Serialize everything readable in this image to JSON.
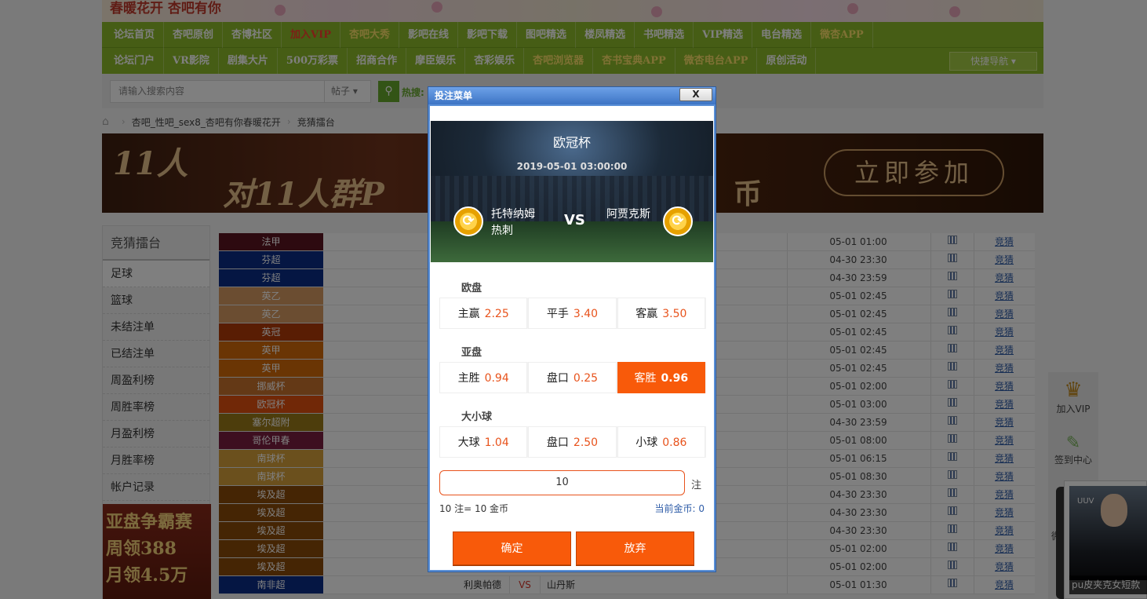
{
  "header": {
    "slogan": "春暖花开 杏吧有你"
  },
  "nav": {
    "row1": [
      "论坛首页",
      "杏吧原创",
      "杏博社区",
      "加入VIP",
      "杏吧大秀",
      "影吧在线",
      "影吧下载",
      "图吧精选",
      "楼凤精选",
      "书吧精选",
      "VIP精选",
      "电台精选",
      "微杏APP"
    ],
    "row2": [
      "论坛门户",
      "VR影院",
      "剧集大片",
      "500万彩票",
      "招商合作",
      "摩臣娱乐",
      "杏彩娱乐",
      "杏吧浏览器",
      "杏书宝典APP",
      "微杏电台APP",
      "原创活动"
    ],
    "quick_nav": "快捷导航 ▾"
  },
  "search": {
    "placeholder": "请输入搜索内容",
    "type": "帖子 ▾",
    "hot_label": "热搜:"
  },
  "breadcrumb": [
    "杏吧_性吧_sex8_杏吧有你春暖花开",
    "竞猜擂台"
  ],
  "ad_banner": {
    "line1": "11人",
    "line2": "对11人群P",
    "tail": "币",
    "cta": "立即参加"
  },
  "sidebar": {
    "title": "竞猜擂台",
    "items": [
      "足球",
      "篮球",
      "未结注单",
      "已结注单",
      "周盈利榜",
      "周胜率榜",
      "月盈利榜",
      "月胜率榜",
      "帐户记录"
    ],
    "ad_lines": [
      "亚盘争霸赛",
      "周领388",
      "月领4.5万"
    ]
  },
  "table": {
    "action_label": "竞猜",
    "rows": [
      {
        "league": "法甲",
        "color": "#5a1420",
        "time": "05-01 01:00"
      },
      {
        "league": "芬超",
        "color": "#0a2d86",
        "time": "04-30 23:30"
      },
      {
        "league": "芬超",
        "color": "#0a2d86",
        "time": "04-30 23:59"
      },
      {
        "league": "英乙",
        "color": "#d79a62",
        "time": "05-01 02:45"
      },
      {
        "league": "英乙",
        "color": "#d79a62",
        "time": "05-01 02:45"
      },
      {
        "league": "英冠",
        "color": "#b23a06",
        "time": "05-01 02:45"
      },
      {
        "league": "英甲",
        "color": "#d46a09",
        "time": "05-01 02:45"
      },
      {
        "league": "英甲",
        "color": "#d46a09",
        "time": "05-01 02:45"
      },
      {
        "league": "挪威杯",
        "color": "#c9722c",
        "time": "05-01 02:00"
      },
      {
        "league": "欧冠杯",
        "color": "#e2510f",
        "time": "05-01 03:00"
      },
      {
        "league": "塞尔超附",
        "color": "#9a7a18",
        "time": "04-30 23:59"
      },
      {
        "league": "哥伦甲春",
        "color": "#7a1f40",
        "time": "05-01 08:00"
      },
      {
        "league": "南球杯",
        "color": "#d6a13a",
        "time": "05-01 06:15"
      },
      {
        "league": "南球杯",
        "color": "#d6a13a",
        "time": "05-01 08:30"
      },
      {
        "league": "埃及超",
        "color": "#8a4a08",
        "time": "04-30 23:30"
      },
      {
        "league": "埃及超",
        "color": "#8a4a08",
        "time": "04-30 23:30"
      },
      {
        "league": "埃及超",
        "color": "#8a4a08",
        "time": "04-30 23:30"
      },
      {
        "league": "埃及超",
        "color": "#8a4a08",
        "time": "05-01 02:00"
      },
      {
        "league": "埃及超",
        "color": "#8a4a08",
        "time": "05-01 02:00"
      },
      {
        "league": "南非超",
        "color": "#0a2d86",
        "time": "05-01 01:30",
        "home": "利奥帕德",
        "vs": "VS",
        "away": "山丹斯"
      }
    ]
  },
  "right_tools": {
    "vip": "加入VIP",
    "checkin": "签到中心",
    "wechat": "微"
  },
  "float_ad": {
    "brand": "UUV",
    "caption": "pu皮夹克女短款"
  },
  "dialog": {
    "title": "投注菜单",
    "close": "X",
    "competition": "欧冠杯",
    "match_time": "2019-05-01 03:00:00",
    "home_team": [
      "托特纳姆",
      "热刺"
    ],
    "away_team": "阿贾克斯",
    "vs": "VS",
    "sections": [
      {
        "label": "欧盘",
        "cells": [
          {
            "name": "主赢",
            "odds": "2.25"
          },
          {
            "name": "平手",
            "odds": "3.40"
          },
          {
            "name": "客赢",
            "odds": "3.50"
          }
        ]
      },
      {
        "label": "亚盘",
        "cells": [
          {
            "name": "主胜",
            "odds": "0.94"
          },
          {
            "name": "盘口",
            "odds": "0.25"
          },
          {
            "name": "客胜",
            "odds": "0.96"
          }
        ]
      },
      {
        "label": "大小球",
        "cells": [
          {
            "name": "大球",
            "odds": "1.04"
          },
          {
            "name": "盘口",
            "odds": "2.50"
          },
          {
            "name": "小球",
            "odds": "0.86"
          }
        ]
      }
    ],
    "bet_value": "10",
    "bet_unit": "注",
    "calc": "10 注= 10 金币",
    "current_coins": "当前金币: 0",
    "confirm": "确定",
    "cancel": "放弃"
  }
}
